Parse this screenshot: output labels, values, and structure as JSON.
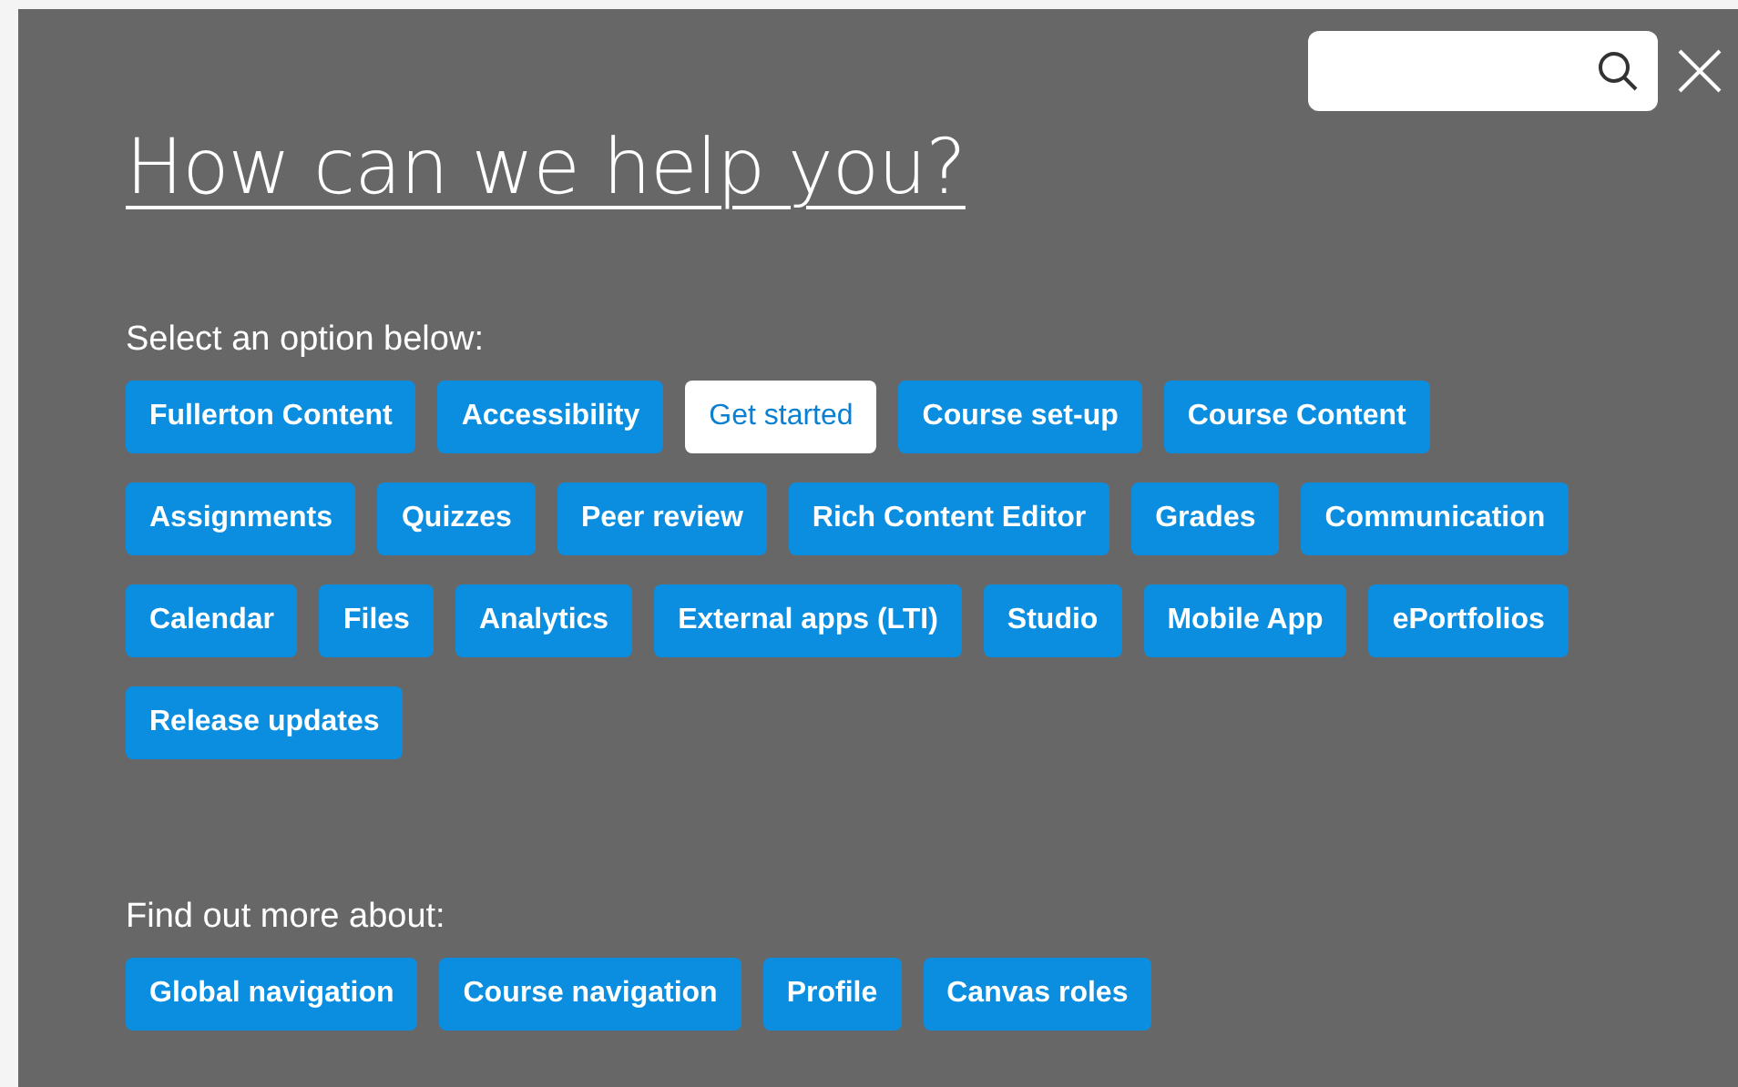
{
  "title": "How can we help you?",
  "sections": [
    {
      "heading": "Select an option below:",
      "options": [
        {
          "label": "Fullerton Content",
          "selected": false
        },
        {
          "label": "Accessibility",
          "selected": false
        },
        {
          "label": "Get started",
          "selected": true
        },
        {
          "label": "Course set-up",
          "selected": false
        },
        {
          "label": "Course Content",
          "selected": false
        },
        {
          "label": "Assignments",
          "selected": false
        },
        {
          "label": "Quizzes",
          "selected": false
        },
        {
          "label": "Peer review",
          "selected": false
        },
        {
          "label": "Rich Content Editor",
          "selected": false
        },
        {
          "label": "Grades",
          "selected": false
        },
        {
          "label": "Communication",
          "selected": false
        },
        {
          "label": "Calendar",
          "selected": false
        },
        {
          "label": "Files",
          "selected": false
        },
        {
          "label": "Analytics",
          "selected": false
        },
        {
          "label": "External apps (LTI)",
          "selected": false
        },
        {
          "label": "Studio",
          "selected": false
        },
        {
          "label": "Mobile App",
          "selected": false
        },
        {
          "label": "ePortfolios",
          "selected": false
        },
        {
          "label": "Release updates",
          "selected": false
        }
      ]
    },
    {
      "heading": "Find out more about:",
      "options": [
        {
          "label": "Global navigation",
          "selected": false
        },
        {
          "label": "Course navigation",
          "selected": false
        },
        {
          "label": "Profile",
          "selected": false
        },
        {
          "label": "Canvas roles",
          "selected": false
        }
      ]
    }
  ]
}
